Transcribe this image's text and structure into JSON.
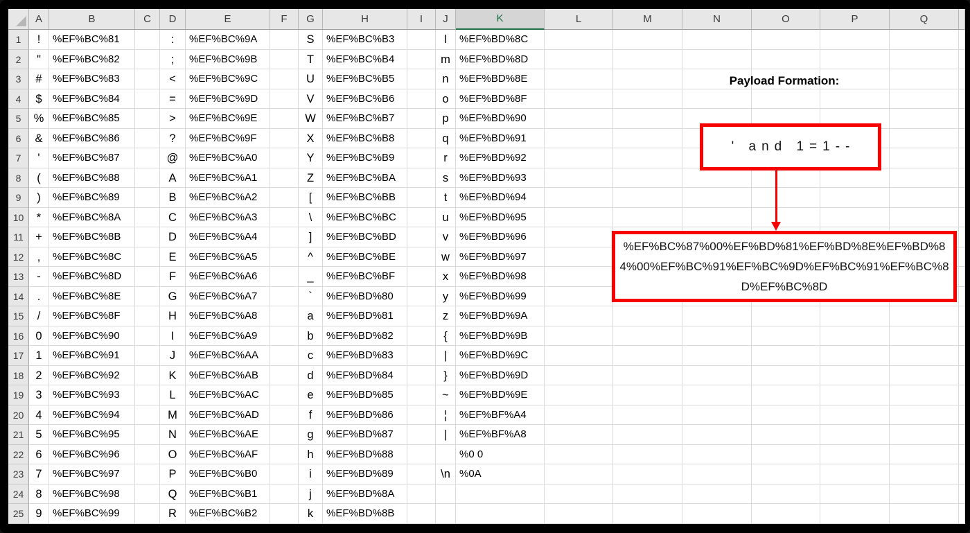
{
  "app": {
    "kind": "spreadsheet",
    "description": "Excel sheet mapping ASCII characters to URL-encoded fullwidth Unicode equivalents"
  },
  "colors": {
    "selection_green": "#1E7145",
    "annotation_red": "#F60000",
    "header_bg": "#E7E7E7",
    "selected_header_bg": "#D5D5D5",
    "gridline": "#DADADA"
  },
  "columns": [
    "A",
    "B",
    "C",
    "D",
    "E",
    "F",
    "G",
    "H",
    "I",
    "J",
    "K",
    "L",
    "M",
    "N",
    "O",
    "P",
    "Q"
  ],
  "selected_column": "K",
  "rows": [
    {
      "n": 1,
      "A": "!",
      "B": "%EF%BC%81",
      "D": ":",
      "E": "%EF%BC%9A",
      "G": "S",
      "H": "%EF%BC%B3",
      "J": "l",
      "K": "%EF%BD%8C"
    },
    {
      "n": 2,
      "A": "\"",
      "B": "%EF%BC%82",
      "D": ";",
      "E": "%EF%BC%9B",
      "G": "T",
      "H": "%EF%BC%B4",
      "J": "m",
      "K": "%EF%BD%8D"
    },
    {
      "n": 3,
      "A": "#",
      "B": "%EF%BC%83",
      "D": "<",
      "E": "%EF%BC%9C",
      "G": "U",
      "H": "%EF%BC%B5",
      "J": "n",
      "K": "%EF%BD%8E"
    },
    {
      "n": 4,
      "A": "$",
      "B": "%EF%BC%84",
      "D": "=",
      "E": "%EF%BC%9D",
      "G": "V",
      "H": "%EF%BC%B6",
      "J": "o",
      "K": "%EF%BD%8F"
    },
    {
      "n": 5,
      "A": "%",
      "B": "%EF%BC%85",
      "D": ">",
      "E": "%EF%BC%9E",
      "G": "W",
      "H": "%EF%BC%B7",
      "J": "p",
      "K": "%EF%BD%90"
    },
    {
      "n": 6,
      "A": "&",
      "B": "%EF%BC%86",
      "D": "?",
      "E": "%EF%BC%9F",
      "G": "X",
      "H": "%EF%BC%B8",
      "J": "q",
      "K": "%EF%BD%91"
    },
    {
      "n": 7,
      "A": "'",
      "B": "%EF%BC%87",
      "D": "@",
      "E": "%EF%BC%A0",
      "G": "Y",
      "H": "%EF%BC%B9",
      "J": "r",
      "K": "%EF%BD%92"
    },
    {
      "n": 8,
      "A": "(",
      "B": "%EF%BC%88",
      "D": "A",
      "E": "%EF%BC%A1",
      "G": "Z",
      "H": "%EF%BC%BA",
      "J": "s",
      "K": "%EF%BD%93"
    },
    {
      "n": 9,
      "A": ")",
      "B": "%EF%BC%89",
      "D": "B",
      "E": "%EF%BC%A2",
      "G": "[",
      "H": "%EF%BC%BB",
      "J": "t",
      "K": "%EF%BD%94"
    },
    {
      "n": 10,
      "A": "*",
      "B": "%EF%BC%8A",
      "D": "C",
      "E": "%EF%BC%A3",
      "G": "\\",
      "H": "%EF%BC%BC",
      "J": "u",
      "K": "%EF%BD%95"
    },
    {
      "n": 11,
      "A": "+",
      "B": "%EF%BC%8B",
      "D": "D",
      "E": "%EF%BC%A4",
      "G": "]",
      "H": "%EF%BC%BD",
      "J": "v",
      "K": "%EF%BD%96"
    },
    {
      "n": 12,
      "A": ",",
      "B": "%EF%BC%8C",
      "D": "E",
      "E": "%EF%BC%A5",
      "G": "^",
      "H": "%EF%BC%BE",
      "J": "w",
      "K": "%EF%BD%97"
    },
    {
      "n": 13,
      "A": "-",
      "B": "%EF%BC%8D",
      "D": "F",
      "E": "%EF%BC%A6",
      "G": "_",
      "H": "%EF%BC%BF",
      "J": "x",
      "K": "%EF%BD%98"
    },
    {
      "n": 14,
      "A": ".",
      "B": "%EF%BC%8E",
      "D": "G",
      "E": "%EF%BC%A7",
      "G": "`",
      "H": "%EF%BD%80",
      "J": "y",
      "K": "%EF%BD%99"
    },
    {
      "n": 15,
      "A": "/",
      "B": "%EF%BC%8F",
      "D": "H",
      "E": "%EF%BC%A8",
      "G": "a",
      "H": "%EF%BD%81",
      "J": "z",
      "K": "%EF%BD%9A"
    },
    {
      "n": 16,
      "A": "0",
      "B": "%EF%BC%90",
      "D": "I",
      "E": "%EF%BC%A9",
      "G": "b",
      "H": "%EF%BD%82",
      "J": "{",
      "K": "%EF%BD%9B"
    },
    {
      "n": 17,
      "A": "1",
      "B": "%EF%BC%91",
      "D": "J",
      "E": "%EF%BC%AA",
      "G": "c",
      "H": "%EF%BD%83",
      "J": "|",
      "K": "%EF%BD%9C"
    },
    {
      "n": 18,
      "A": "2",
      "B": "%EF%BC%92",
      "D": "K",
      "E": "%EF%BC%AB",
      "G": "d",
      "H": "%EF%BD%84",
      "J": "}",
      "K": "%EF%BD%9D"
    },
    {
      "n": 19,
      "A": "3",
      "B": "%EF%BC%93",
      "D": "L",
      "E": "%EF%BC%AC",
      "G": "e",
      "H": "%EF%BD%85",
      "J": "~",
      "K": "%EF%BD%9E"
    },
    {
      "n": 20,
      "A": "4",
      "B": "%EF%BC%94",
      "D": "M",
      "E": "%EF%BC%AD",
      "G": "f",
      "H": "%EF%BD%86",
      "J": "¦",
      "K": "%EF%BF%A4"
    },
    {
      "n": 21,
      "A": "5",
      "B": "%EF%BC%95",
      "D": "N",
      "E": "%EF%BC%AE",
      "G": "g",
      "H": "%EF%BD%87",
      "J": "|",
      "K": "%EF%BF%A8"
    },
    {
      "n": 22,
      "A": "6",
      "B": "%EF%BC%96",
      "D": "O",
      "E": "%EF%BC%AF",
      "G": "h",
      "H": "%EF%BD%88",
      "J": "",
      "K": "%0 0"
    },
    {
      "n": 23,
      "A": "7",
      "B": "%EF%BC%97",
      "D": "P",
      "E": "%EF%BC%B0",
      "G": "i",
      "H": "%EF%BD%89",
      "J": "\\n",
      "K": "%0A"
    },
    {
      "n": 24,
      "A": "8",
      "B": "%EF%BC%98",
      "D": "Q",
      "E": "%EF%BC%B1",
      "G": "j",
      "H": "%EF%BD%8A",
      "J": "",
      "K": ""
    },
    {
      "n": 25,
      "A": "9",
      "B": "%EF%BC%99",
      "D": "R",
      "E": "%EF%BC%B2",
      "G": "k",
      "H": "%EF%BD%8B",
      "J": "",
      "K": ""
    }
  ],
  "annotation": {
    "title": "Payload Formation:",
    "payload_plain": "' and 1=1--",
    "payload_encoded": "%EF%BC%87%00%EF%BD%81%EF%BD%8E%EF%BD%84%00%EF%BC%91%EF%BC%9D%EF%BC%91%EF%BC%8D%EF%BC%8D"
  }
}
